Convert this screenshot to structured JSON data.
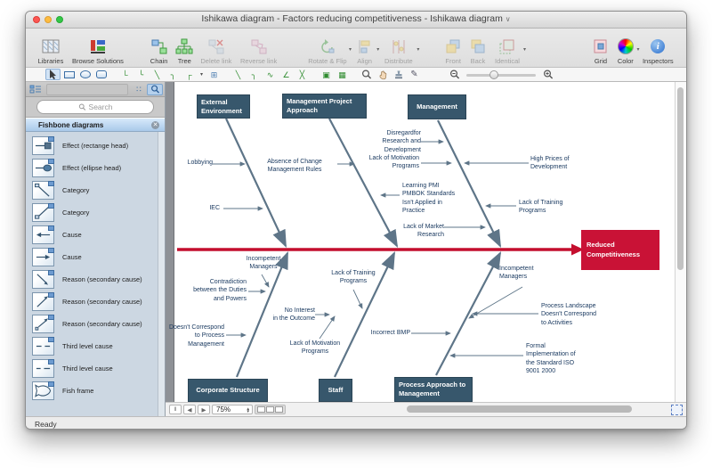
{
  "titlebar": {
    "title": "Ishikawa diagram - Factors reducing competitiveness - Ishikawa diagram",
    "chevron": "∨"
  },
  "toolbar1": {
    "items": [
      {
        "label": "Libraries",
        "disabled": false
      },
      {
        "label": "Browse Solutions",
        "disabled": false
      },
      {
        "label": "Chain",
        "disabled": false
      },
      {
        "label": "Tree",
        "disabled": false
      },
      {
        "label": "Delete link",
        "disabled": true
      },
      {
        "label": "Reverse link",
        "disabled": true
      },
      {
        "label": "Rotate & Flip",
        "disabled": true
      },
      {
        "label": "Align",
        "disabled": true
      },
      {
        "label": "Distribute",
        "disabled": true
      },
      {
        "label": "Front",
        "disabled": true
      },
      {
        "label": "Back",
        "disabled": true
      },
      {
        "label": "Identical",
        "disabled": true
      },
      {
        "label": "Grid",
        "disabled": false
      },
      {
        "label": "Color",
        "disabled": false
      },
      {
        "label": "Inspectors",
        "disabled": false
      }
    ]
  },
  "sidebar": {
    "search_placeholder": "Search",
    "panel_title": "Fishbone diagrams",
    "close_glyph": "✕",
    "items": [
      "Effect (rectange head)",
      "Effect (ellipse head)",
      "Category",
      "Category",
      "Cause",
      "Cause",
      "Reason (secondary cause)",
      "Reason (secondary cause)",
      "Reason (secondary cause)",
      "Third level cause",
      "Third level cause",
      "Fish frame"
    ]
  },
  "diagram": {
    "effect": "Reduced\nCompetitiveness",
    "categories_top": [
      "External\nEnvironment",
      "Management Project\nApproach",
      "Management"
    ],
    "categories_bottom": [
      "Corporate Structure",
      "Staff",
      "Process Approach to\nManagement"
    ],
    "causes": {
      "lobbying": "Lobbying",
      "absence": "Absence of Change\nManagement Rules",
      "iec": "IEC",
      "disregard": "Disregardfor\nResearch and\nDevelopment",
      "lack_motivation_top": "Lack of Motivation\nPrograms",
      "high_prices": "High Prices of\nDevelopment",
      "learning_pmi": "Learning PMI\nPMBOK Standards\nIsn't Applied in\nPractice",
      "lack_training_top": "Lack of Training\nPrograms",
      "lack_market": "Lack of Market\nResearch",
      "incompetent_left": "Incompetent\nManagers",
      "contradiction": "Contradiction\nbetween the Duties\nand Powers",
      "doesnt_correspond": "Doesn't Correspond\nto Process\nManagement",
      "lack_training_bottom": "Lack of Training\nPrograms",
      "no_interest": "No Interest\nin the Outcome",
      "lack_motivation_bottom": "Lack of Motivation\nPrograms",
      "incorrect_bmp": "Incorrect BMP",
      "incompetent_right": "Incompetent\nManagers",
      "process_landscape": "Process Landscape\nDoesn't Correspond\nto Activities",
      "formal_iso": "Formal\nImplementation of\nthe Standard ISO\n9001 2000"
    },
    "colors": {
      "category_fill": "#37576C",
      "effect_fill": "#C91236",
      "spine": "#C40F2E",
      "bone": "#5E7588",
      "label_text": "#17375E"
    }
  },
  "footer": {
    "zoom_level": "75%"
  },
  "statusbar": {
    "ready": "Ready"
  }
}
